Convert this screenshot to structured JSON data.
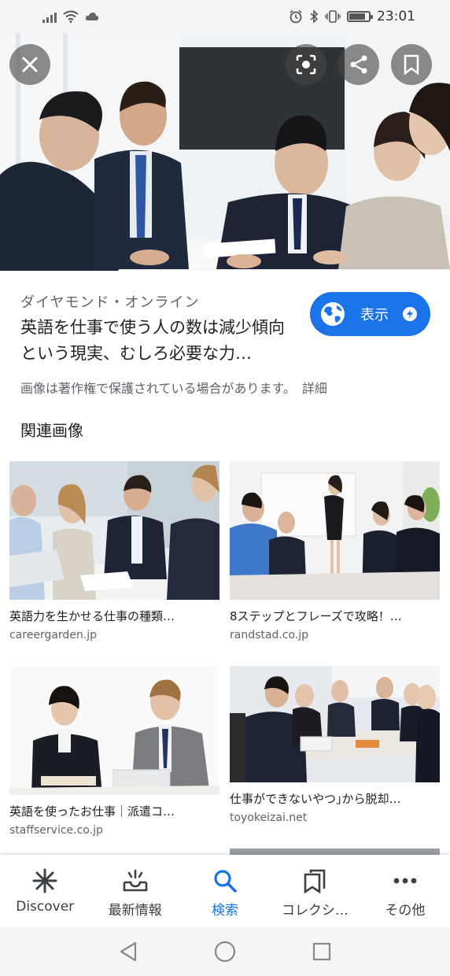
{
  "status_bar": {
    "time": "23:01",
    "left_icons": [
      "signal-icon",
      "wifi-icon",
      "cloud-icon"
    ],
    "right_icons": [
      "alarm-icon",
      "bluetooth-icon",
      "vibrate-icon",
      "battery-icon"
    ],
    "battery_level": 0.85
  },
  "hero": {
    "buttons": [
      "close-icon",
      "lens-icon",
      "share-icon",
      "bookmark-icon"
    ]
  },
  "result": {
    "source": "ダイヤモンド・オンライン",
    "title": "英語を仕事で使う人の数は減少傾向という現実、むしろ必要な力…",
    "view_button": "表示",
    "copyright_notice": "画像は著作権で保護されている場合があります。",
    "details_link": "詳細"
  },
  "related": {
    "heading": "関連画像",
    "items": [
      {
        "title": "英語力を生かせる仕事の種類…",
        "domain": "careergarden.jp"
      },
      {
        "title": "8ステップとフレーズで攻略！…",
        "domain": "randstad.co.jp"
      },
      {
        "title": "英語を使ったお仕事｜派遣コ…",
        "domain": "staffservice.co.jp"
      },
      {
        "title": "仕事ができないやつ｣から脱却…",
        "domain": "toyokeizai.net"
      }
    ]
  },
  "bottom_nav": [
    {
      "label": "Discover",
      "icon": "asterisk-icon",
      "active": false
    },
    {
      "label": "最新情報",
      "icon": "updates-icon",
      "active": false
    },
    {
      "label": "検索",
      "icon": "search-icon",
      "active": true
    },
    {
      "label": "コレクシ…",
      "icon": "collections-icon",
      "active": false
    },
    {
      "label": "その他",
      "icon": "more-icon",
      "active": false
    }
  ],
  "colors": {
    "accent": "#1a73e8",
    "text_primary": "#202124",
    "text_secondary": "#5f6368"
  }
}
